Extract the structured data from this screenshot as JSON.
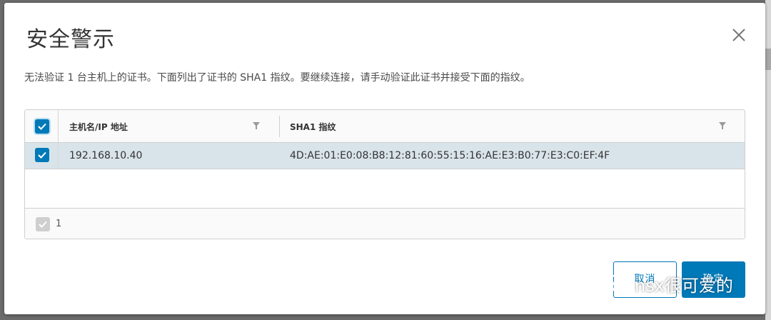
{
  "dialog": {
    "title": "安全警示",
    "message": "无法验证 1 台主机上的证书。下面列出了证书的 SHA1 指纹。要继续连接，请手动验证此证书并接受下面的指纹。"
  },
  "grid": {
    "columns": [
      "主机名/IP 地址",
      "SHA1 指纹"
    ],
    "rows": [
      {
        "host": "192.168.10.40",
        "sha1": "4D:AE:01:E0:08:B8:12:81:60:55:15:16:AE:E3:B0:77:E3:C0:EF:4F",
        "selected": true
      }
    ],
    "footer_count": "1"
  },
  "buttons": {
    "cancel": "取消",
    "ok": "确定"
  },
  "watermark": {
    "text": "nsx很可爱的"
  },
  "colors": {
    "accent": "#0079b8",
    "row_selected": "#d9e4ea"
  },
  "icons": [
    "close-icon",
    "check-icon",
    "filter-icon",
    "wechat-logo-icon"
  ]
}
